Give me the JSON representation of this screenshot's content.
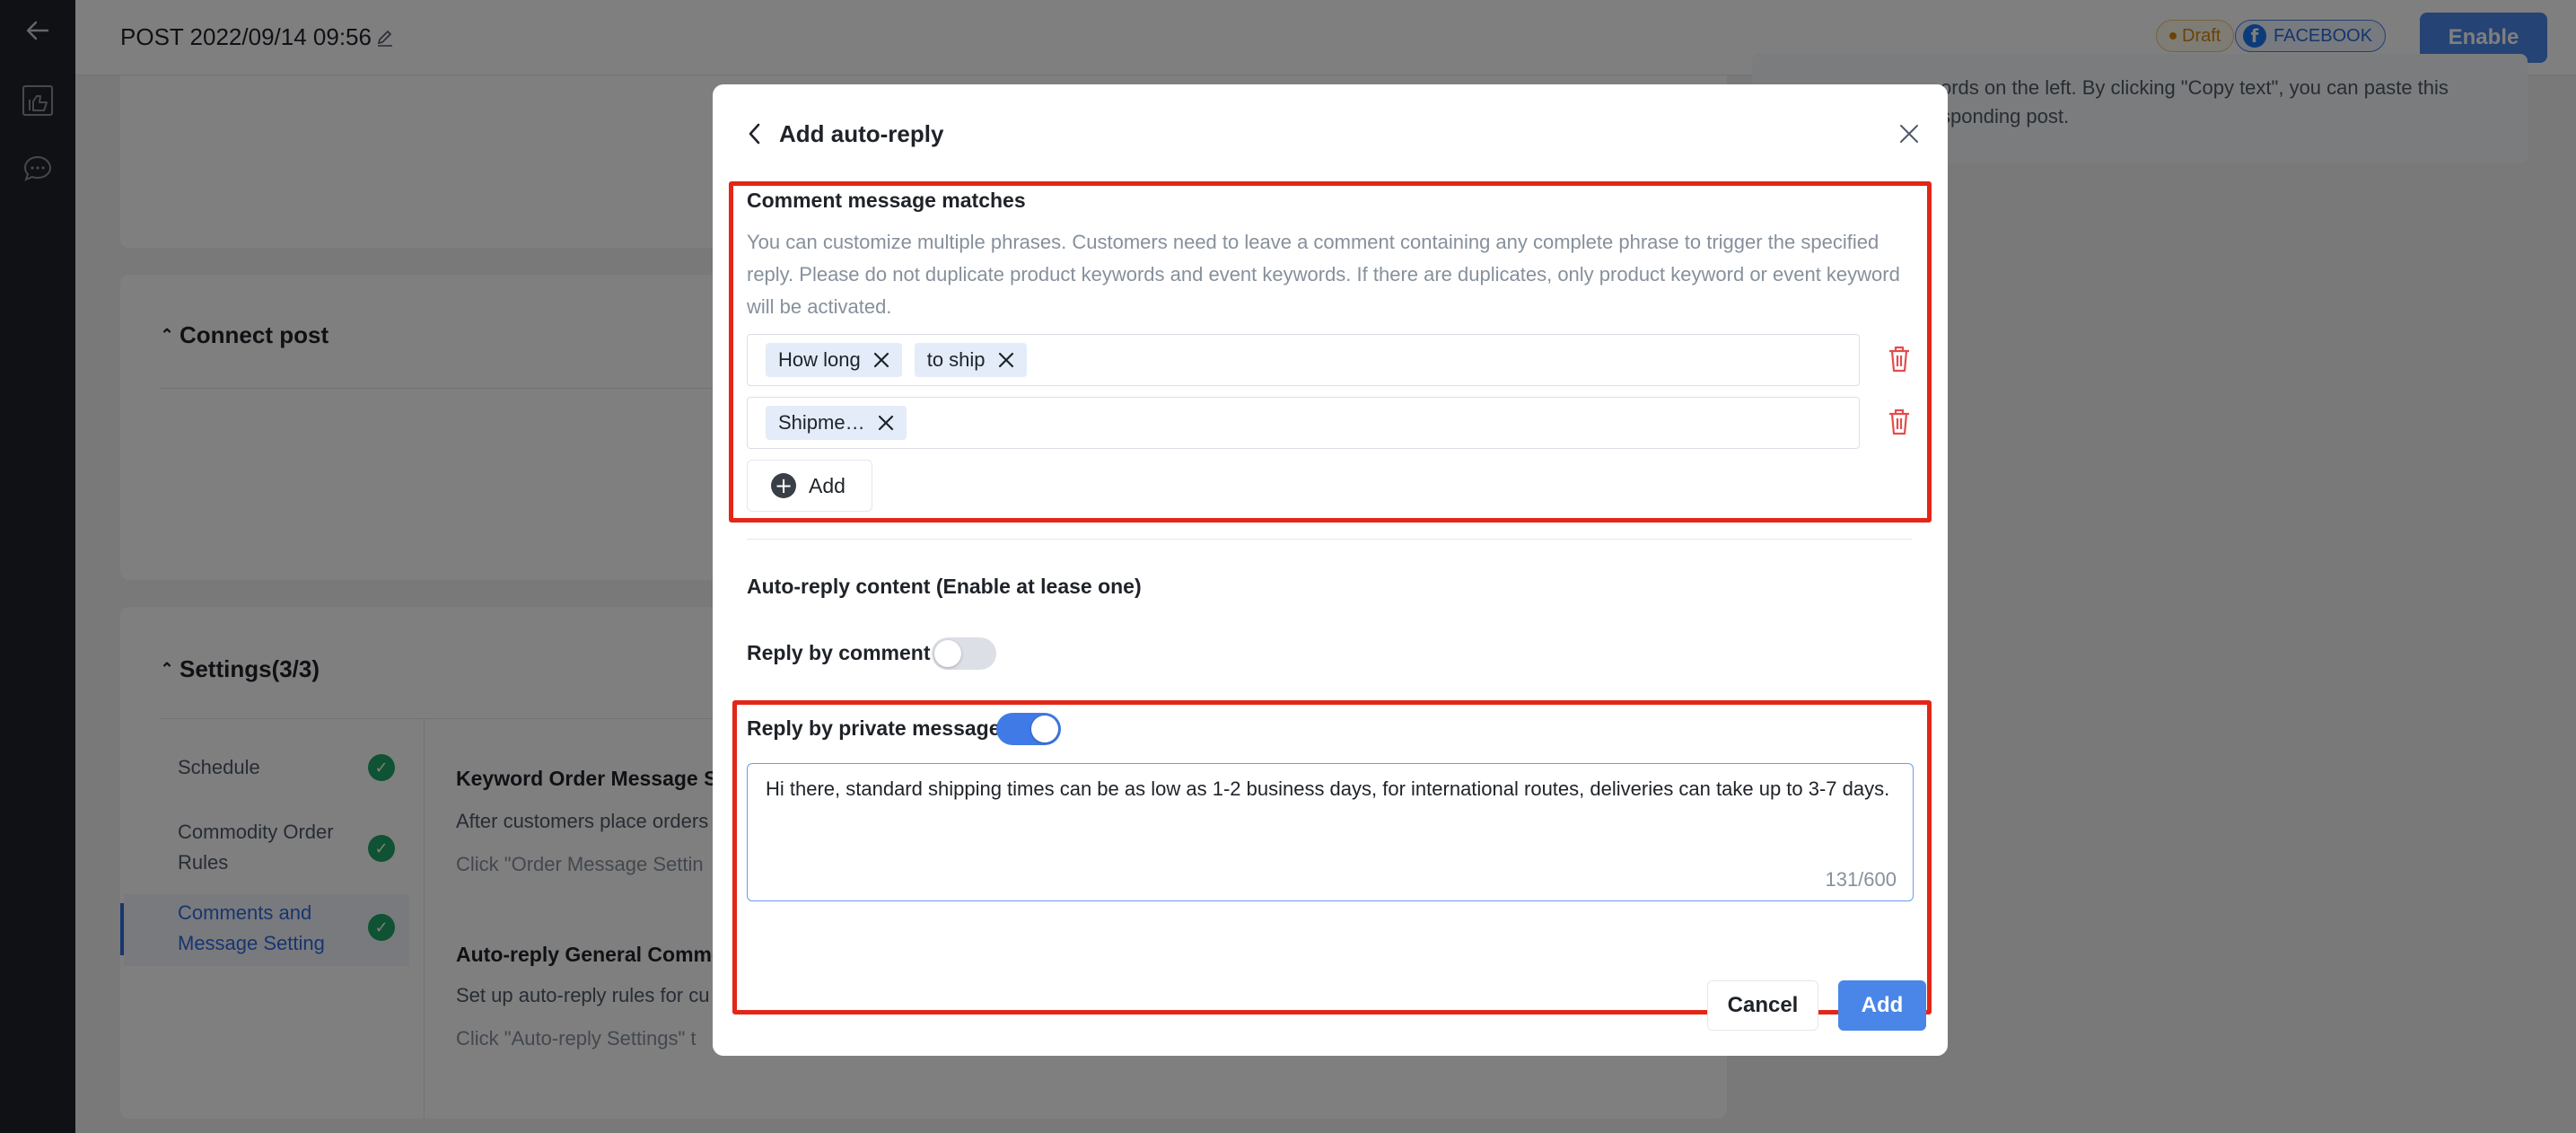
{
  "header": {
    "title": "POST 2022/09/14 09:56",
    "status_badge": "Draft",
    "platform_badge": "FACEBOOK",
    "enable_label": "Enable"
  },
  "right_panel": {
    "line1": "ords on the left. By clicking \"Copy text\", you can paste this",
    "line2": "sponding post."
  },
  "sections": {
    "connect_post": "Connect post",
    "settings": "Settings(3/3)"
  },
  "settings_nav": [
    {
      "label": "Schedule"
    },
    {
      "label": "Commodity Order Rules"
    },
    {
      "label": "Comments and Message Setting"
    }
  ],
  "settings_content": {
    "keyword_title": "Keyword Order Message Se",
    "keyword_line1": "After customers place orders",
    "keyword_line2": "Click \"Order Message Settin",
    "autoreply_title": "Auto-reply General Comme",
    "autoreply_line1": "Set up auto-reply rules for cu",
    "autoreply_line2": "Click \"Auto-reply Settings\" t"
  },
  "modal": {
    "title": "Add auto-reply",
    "comment_matches": {
      "title": "Comment message matches",
      "description": "You can customize multiple phrases. Customers need to leave a comment containing any complete phrase to trigger the specified reply. Please do not duplicate product keywords and event keywords. If there are duplicates, only product keyword or event keyword will be activated.",
      "rows": [
        {
          "tags": [
            "How long",
            "to ship"
          ]
        },
        {
          "tags": [
            "Shipme…"
          ]
        }
      ],
      "add_label": "Add"
    },
    "autoreply_content": {
      "title": "Auto-reply content (Enable at lease one)",
      "reply_by_comment": {
        "label": "Reply by comment",
        "enabled": false
      },
      "reply_by_private_message": {
        "label": "Reply by private message",
        "enabled": true,
        "message": "Hi there, standard shipping times can be as low as 1-2 business days, for international routes, deliveries can take up to 3-7 days.",
        "counter": "131/600"
      }
    },
    "cancel_label": "Cancel",
    "add_label": "Add"
  },
  "colors": {
    "primary": "#4a86e8",
    "highlight": "#e32618",
    "success": "#1fa569",
    "danger": "#e34d4d"
  }
}
